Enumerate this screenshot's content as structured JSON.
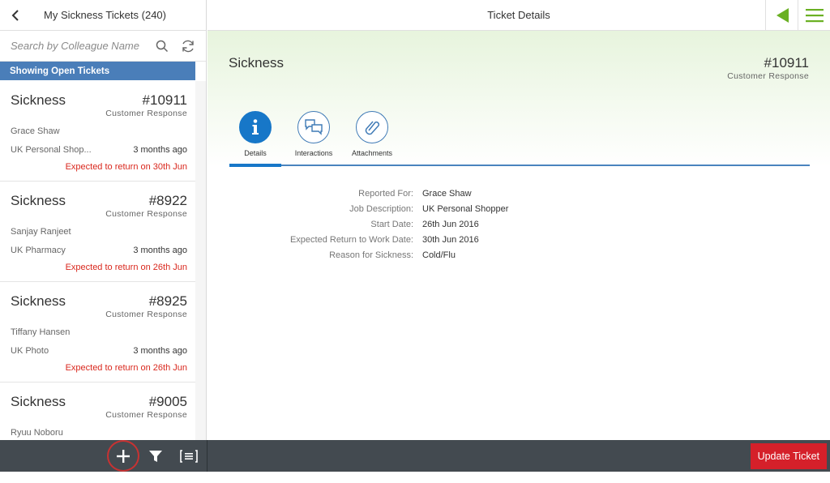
{
  "master": {
    "title": "My Sickness Tickets (240)",
    "search_placeholder": "Search by Colleague Name",
    "info_bar": "Showing Open Tickets",
    "items": [
      {
        "title": "Sickness",
        "number": "#10911",
        "attr": "Customer Response",
        "name": "Grace Shaw",
        "location": "UK Personal Shop...",
        "time": "3 months ago",
        "status": "Expected to return on 30th Jun"
      },
      {
        "title": "Sickness",
        "number": "#8922",
        "attr": "Customer Response",
        "name": "Sanjay Ranjeet",
        "location": "UK Pharmacy",
        "time": "3 months ago",
        "status": "Expected to return on 26th Jun"
      },
      {
        "title": "Sickness",
        "number": "#8925",
        "attr": "Customer Response",
        "name": "Tiffany Hansen",
        "location": "UK Photo",
        "time": "3 months ago",
        "status": "Expected to return on 26th Jun"
      },
      {
        "title": "Sickness",
        "number": "#9005",
        "attr": "Customer Response",
        "name": "Ryuu Noboru",
        "location": "",
        "time": "",
        "status": ""
      }
    ]
  },
  "detail": {
    "title": "Ticket Details",
    "object": {
      "title": "Sickness",
      "number": "#10911",
      "attr": "Customer Response"
    },
    "tabs": [
      {
        "label": "Details",
        "icon": "info-icon"
      },
      {
        "label": "Interactions",
        "icon": "chat-icon"
      },
      {
        "label": "Attachments",
        "icon": "paperclip-icon"
      }
    ],
    "fields": [
      {
        "label": "Reported For:",
        "value": "Grace Shaw"
      },
      {
        "label": "Job Description:",
        "value": "UK Personal Shopper"
      },
      {
        "label": "Start Date:",
        "value": "26th Jun 2016"
      },
      {
        "label": "Expected Return to Work Date:",
        "value": "30th Jun 2016"
      },
      {
        "label": "Reason for Sickness:",
        "value": "Cold/Flu"
      }
    ]
  },
  "footer": {
    "update_label": "Update Ticket"
  },
  "colors": {
    "accent": "#1777c8",
    "info_bar": "#4a7eb9",
    "status_red": "#d9271d",
    "footer": "#434a50",
    "update_button": "#d5202a",
    "brand_green": "#6ab023"
  }
}
